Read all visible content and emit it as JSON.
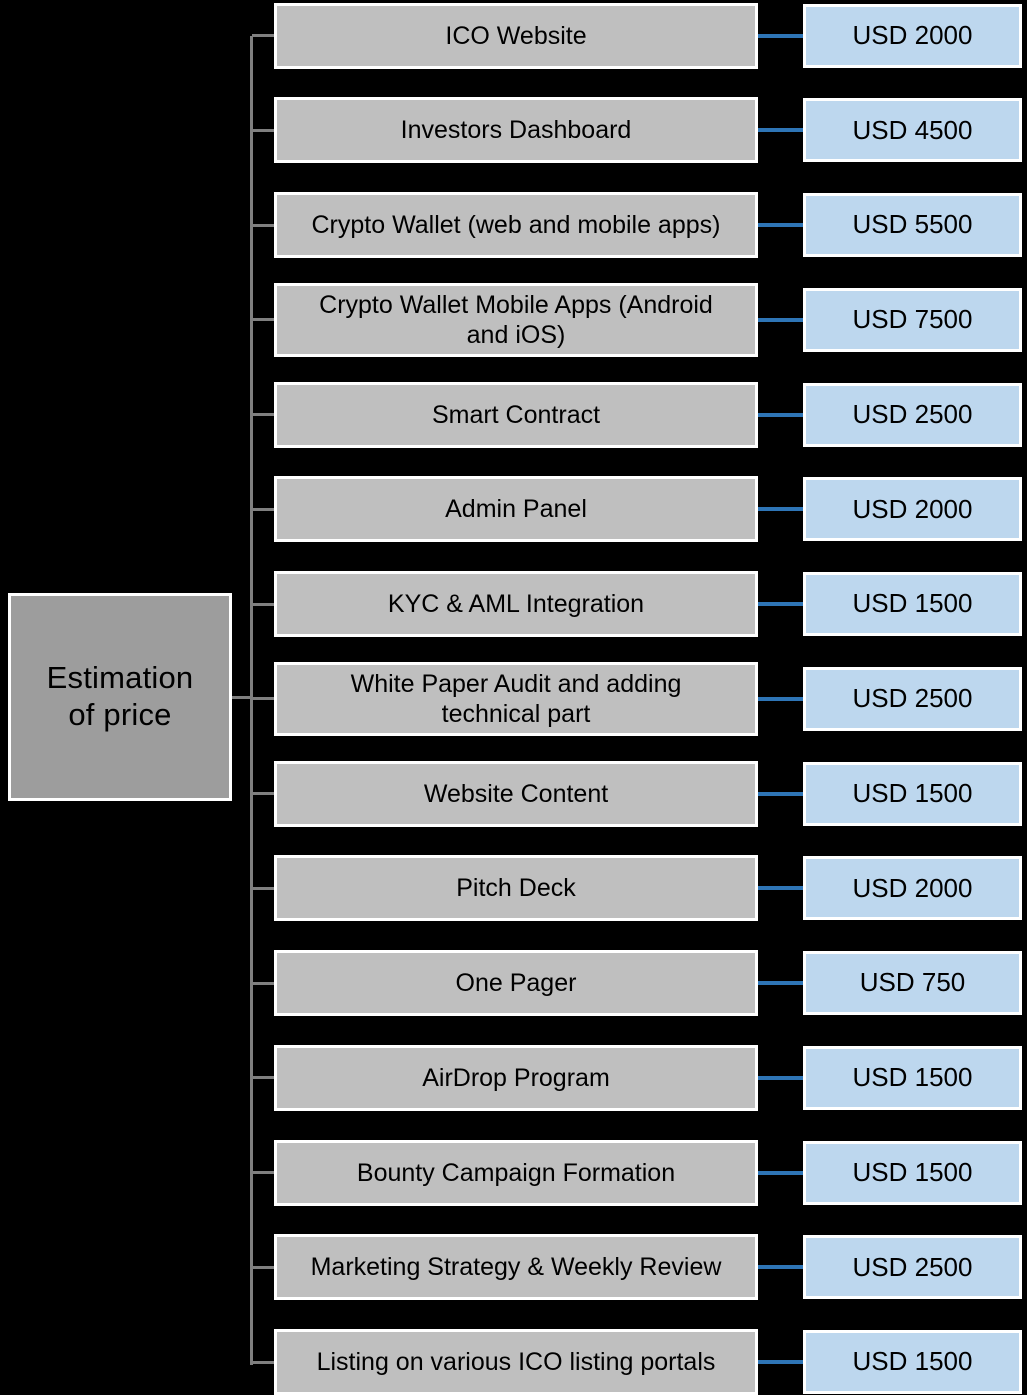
{
  "diagram": {
    "type": "horizontal-tree",
    "title": "Estimation of price",
    "root": {
      "label": "Estimation\nof price",
      "fill": "#9d9d9d",
      "border": "#ffffff"
    },
    "colors": {
      "background": "#000000",
      "item_fill": "#bfbfbf",
      "price_fill": "#bdd7ee",
      "box_border": "#ffffff",
      "branch_line": "#7f7f7f",
      "price_line": "#2e75b6",
      "text": "#000000"
    },
    "currency": "USD",
    "rows": [
      {
        "item": "ICO Website",
        "price": "USD 2000",
        "amount": 2000,
        "lines": 1
      },
      {
        "item": "Investors Dashboard",
        "price": "USD 4500",
        "amount": 4500,
        "lines": 1
      },
      {
        "item": "Crypto Wallet (web and mobile apps)",
        "price": "USD 5500",
        "amount": 5500,
        "lines": 1
      },
      {
        "item": "Crypto Wallet Mobile Apps (Android\nand iOS)",
        "price": "USD 7500",
        "amount": 7500,
        "lines": 2
      },
      {
        "item": "Smart Contract",
        "price": "USD 2500",
        "amount": 2500,
        "lines": 1
      },
      {
        "item": "Admin Panel",
        "price": "USD 2000",
        "amount": 2000,
        "lines": 1
      },
      {
        "item": "KYC & AML Integration",
        "price": "USD 1500",
        "amount": 1500,
        "lines": 1
      },
      {
        "item": "White Paper Audit and adding\ntechnical part",
        "price": "USD 2500",
        "amount": 2500,
        "lines": 2
      },
      {
        "item": "Website Content",
        "price": "USD 1500",
        "amount": 1500,
        "lines": 1
      },
      {
        "item": "Pitch Deck",
        "price": "USD 2000",
        "amount": 2000,
        "lines": 1
      },
      {
        "item": "One Pager",
        "price": "USD 750",
        "amount": 750,
        "lines": 1
      },
      {
        "item": "AirDrop Program",
        "price": "USD 1500",
        "amount": 1500,
        "lines": 1
      },
      {
        "item": "Bounty Campaign Formation",
        "price": "USD 1500",
        "amount": 1500,
        "lines": 1
      },
      {
        "item": "Marketing Strategy & Weekly Review",
        "price": "USD 2500",
        "amount": 2500,
        "lines": 1
      },
      {
        "item": "Listing on various ICO listing portals",
        "price": "USD 1500",
        "amount": 1500,
        "lines": 1
      }
    ]
  }
}
